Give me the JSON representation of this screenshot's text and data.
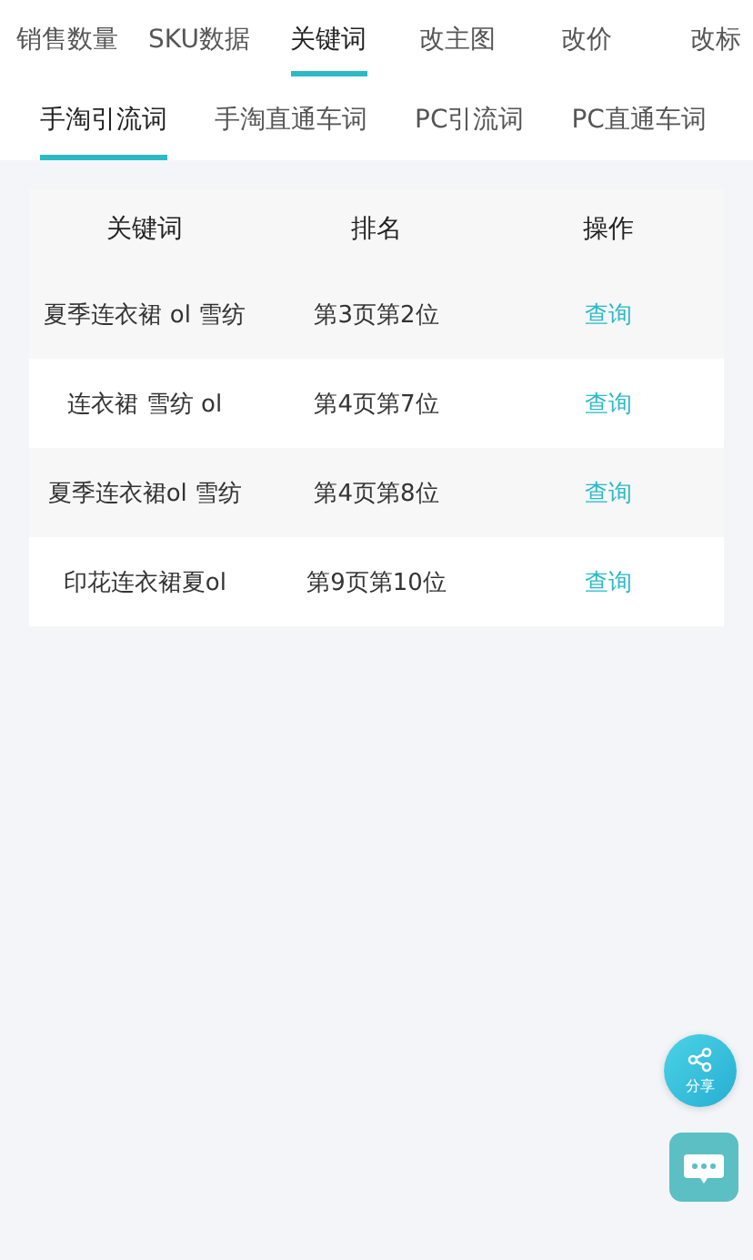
{
  "main_tabs": [
    {
      "label": "销售数量",
      "selected": false
    },
    {
      "label": "SKU数据",
      "selected": false
    },
    {
      "label": "关键词",
      "selected": true
    },
    {
      "label": "改主图",
      "selected": false
    },
    {
      "label": "改价",
      "selected": false
    },
    {
      "label": "改标",
      "selected": false
    }
  ],
  "sub_tabs": [
    {
      "label": "手淘引流词",
      "selected": true
    },
    {
      "label": "手淘直通车词",
      "selected": false
    },
    {
      "label": "PC引流词",
      "selected": false
    },
    {
      "label": "PC直通车词",
      "selected": false
    }
  ],
  "table": {
    "columns": [
      "关键词",
      "排名",
      "操作"
    ],
    "rows": [
      {
        "keyword": "夏季连衣裙 ol 雪纺",
        "rank": "第3页第2位",
        "action": "查询"
      },
      {
        "keyword": "连衣裙 雪纺 ol",
        "rank": "第4页第7位",
        "action": "查询"
      },
      {
        "keyword": "夏季连衣裙ol 雪纺",
        "rank": "第4页第8位",
        "action": "查询"
      },
      {
        "keyword": "印花连衣裙夏ol",
        "rank": "第9页第10位",
        "action": "查询"
      }
    ]
  },
  "share_button": {
    "label": "分享"
  }
}
